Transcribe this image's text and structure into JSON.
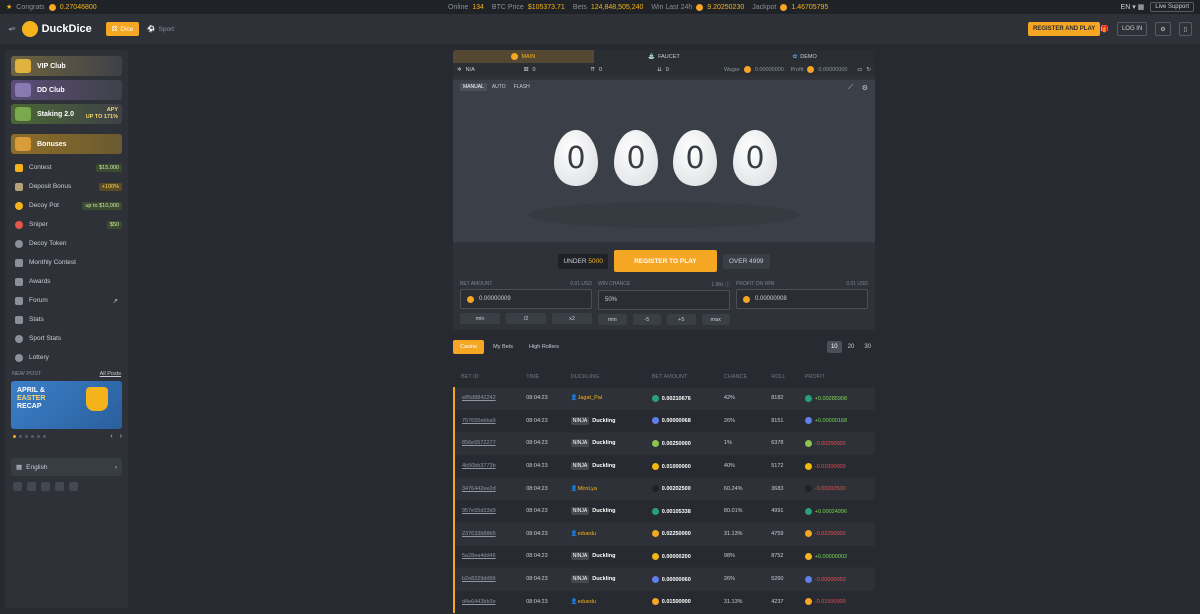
{
  "topbar": {
    "congrats_label": "Congrats",
    "congrats_value": "0.27046800",
    "online_label": "Online",
    "online_value": "134",
    "btc_label": "BTC Price",
    "btc_value": "$105373.71",
    "bets_label": "Bets",
    "bets_value": "124,848,505,240",
    "win_label": "Win Last 24h",
    "win_value": "9.20250230",
    "jackpot_label": "Jackpot",
    "jackpot_value": "1.46705795",
    "lang": "EN",
    "support": "Live Support"
  },
  "header": {
    "logo": "DuckDice",
    "nav_dice": "Dice",
    "nav_sport": "Sport",
    "register": "REGISTER AND PLAY",
    "login": "LOG IN"
  },
  "sidebar": {
    "vip": "VIP Club",
    "dd": "DD Club",
    "staking": "Staking 2.0",
    "apy_line1": "APY",
    "apy_line2": "UP TO 171%",
    "bonuses": "Bonuses",
    "items": [
      {
        "label": "Contest",
        "tag": "$15,000",
        "icon": "trophy-icon"
      },
      {
        "label": "Deposit Bonus",
        "tag": "+100%",
        "icon": "deposit-icon"
      },
      {
        "label": "Decoy Pot",
        "tag": "up to $10,000",
        "icon": "duck-icon"
      },
      {
        "label": "Sniper",
        "tag": "$50",
        "icon": "target-icon"
      },
      {
        "label": "Decoy Token",
        "tag": "",
        "icon": "token-icon"
      },
      {
        "label": "Monthly Contest",
        "tag": "",
        "icon": "calendar-icon"
      },
      {
        "label": "Awards",
        "tag": "",
        "icon": "award-icon"
      },
      {
        "label": "Forum",
        "tag": "",
        "icon": "forum-icon"
      },
      {
        "label": "Stats",
        "tag": "",
        "icon": "stats-icon"
      },
      {
        "label": "Sport Stats",
        "tag": "",
        "icon": "sport-icon"
      },
      {
        "label": "Lottery",
        "tag": "",
        "icon": "lottery-icon"
      }
    ],
    "new_post": "NEW POST",
    "all_posts": "All Posts",
    "banner_line1": "APRIL &",
    "banner_line2": "EASTER",
    "banner_line3": "RECAP",
    "language": "English"
  },
  "game": {
    "tab_main": "MAIN",
    "tab_faucet": "FAUCET",
    "tab_demo": "DEMO",
    "stat_na": "N/A",
    "stat_a": "0",
    "stat_b": "0",
    "stat_c": "0",
    "wager_label": "Wager",
    "wager_value": "0.00000000",
    "profit_label": "Profit",
    "profit_value": "0.00000000",
    "mode_manual": "MANUAL",
    "mode_auto": "AUTO",
    "mode_flash": "FLASH",
    "eggs": [
      "0",
      "0",
      "0",
      "0"
    ],
    "under": "UNDER",
    "under_value": "5000",
    "register": "REGISTER TO PLAY",
    "over": "OVER 4999",
    "bet_label": "BET AMOUNT",
    "bet_usd": "0.01 USD",
    "bet_value": "0.00000009",
    "chance_label": "WIN CHANCE",
    "chance_mult": "1.98x",
    "chance_value": "50%",
    "profit_win_label": "PROFIT ON WIN",
    "profit_win_usd": "0.01 USD",
    "profit_win_value": "0.00000008",
    "bet_btns": [
      "min",
      "/2",
      "x2"
    ],
    "chance_btns": [
      "min",
      "-5",
      "+5",
      "max"
    ]
  },
  "bets": {
    "tab_casino": "Casino",
    "tab_mine": "My Bets",
    "tab_high": "High Rollers",
    "pages": [
      "10",
      "20",
      "30"
    ],
    "headers": [
      "BET ID",
      "TIME",
      "DUCKLING",
      "BET AMOUNT",
      "CHANCE",
      "ROLL",
      "PROFIT"
    ],
    "rows": [
      {
        "id": "e85d8842242",
        "time": "08:04:23",
        "ninja": false,
        "user": "Jagat_Pal",
        "amount": "0.00210676",
        "chance": "42%",
        "roll": "8182",
        "profit": "+0.00285908",
        "positive": true,
        "color": "#26a17b"
      },
      {
        "id": "757655ebba9",
        "time": "08:04:23",
        "ninja": true,
        "user": "Duckling",
        "amount": "0.00000068",
        "chance": "26%",
        "roll": "8151",
        "profit": "+0.00000168",
        "positive": true,
        "color": "#627eea"
      },
      {
        "id": "856e5572277",
        "time": "08:04:23",
        "ninja": true,
        "user": "Duckling",
        "amount": "0.00250000",
        "chance": "1%",
        "roll": "6378",
        "profit": "-0.00250000",
        "positive": false,
        "color": "#8dc351"
      },
      {
        "id": "4b56bb3773b",
        "time": "08:04:23",
        "ninja": true,
        "user": "Duckling",
        "amount": "0.01000000",
        "chance": "40%",
        "roll": "5172",
        "profit": "-0.01000000",
        "positive": false,
        "color": "#f0b90b"
      },
      {
        "id": "3476442ee2d",
        "time": "08:04:23",
        "ninja": false,
        "user": "MiroLya",
        "amount": "0.00202500",
        "chance": "60.24%",
        "roll": "3683",
        "profit": "-0.00202500",
        "positive": false,
        "color": "#1f2227"
      },
      {
        "id": "957e55d33d9",
        "time": "08:04:23",
        "ninja": true,
        "user": "Duckling",
        "amount": "0.00105338",
        "chance": "80.01%",
        "roll": "4991",
        "profit": "+0.00024996",
        "positive": true,
        "color": "#26a17b"
      },
      {
        "id": "237633b88b5",
        "time": "08:04:23",
        "ninja": false,
        "user": "eduedu",
        "amount": "0.02250000",
        "chance": "31.13%",
        "roll": "4759",
        "profit": "-0.02250000",
        "positive": false,
        "color": "#f5a623"
      },
      {
        "id": "5a28ea4dd46",
        "time": "08:04:23",
        "ninja": true,
        "user": "Duckling",
        "amount": "0.00000200",
        "chance": "98%",
        "roll": "8752",
        "profit": "+0.00000002",
        "positive": true,
        "color": "#f5b31b"
      },
      {
        "id": "b2e8229dd96",
        "time": "08:04:23",
        "ninja": true,
        "user": "Duckling",
        "amount": "0.00000060",
        "chance": "26%",
        "roll": "5260",
        "profit": "-0.00000060",
        "positive": false,
        "color": "#627eea"
      },
      {
        "id": "d4e6443bb3e",
        "time": "08:04:23",
        "ninja": false,
        "user": "eduedu",
        "amount": "0.01500000",
        "chance": "31.13%",
        "roll": "4237",
        "profit": "-0.01500000",
        "positive": false,
        "color": "#f5a623"
      }
    ]
  }
}
